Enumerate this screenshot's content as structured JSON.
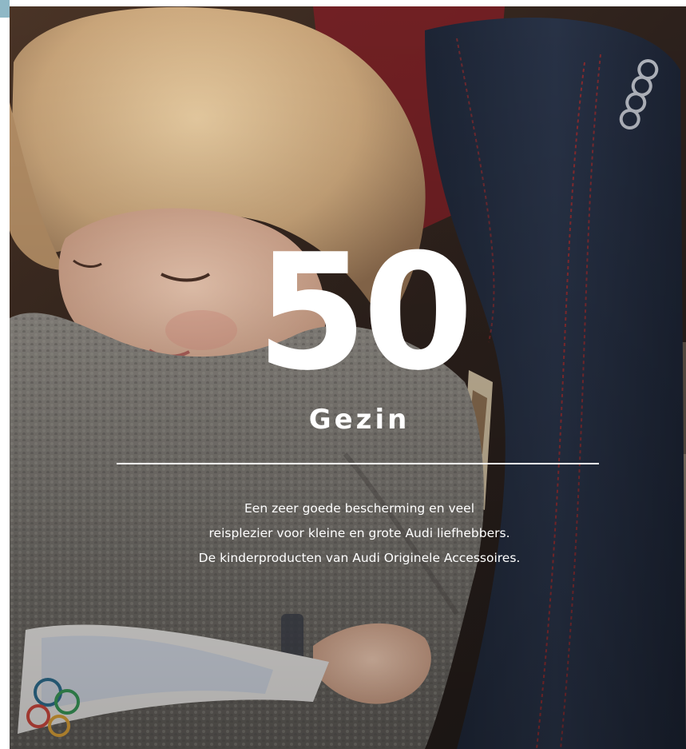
{
  "hero": {
    "number": "50",
    "title": "Gezin"
  },
  "intro": {
    "lines": [
      "Een zeer goede bescherming en veel",
      "reisplezier voor kleine en grote Audi liefhebbers.",
      "De kinderproducten van Audi Originele Accessoires."
    ]
  },
  "colors": {
    "page_background": "#ffffff",
    "text": "#ffffff",
    "corner_tab": "#8fb8c6"
  },
  "icons": {
    "seat_logo": "audi-rings-icon"
  }
}
